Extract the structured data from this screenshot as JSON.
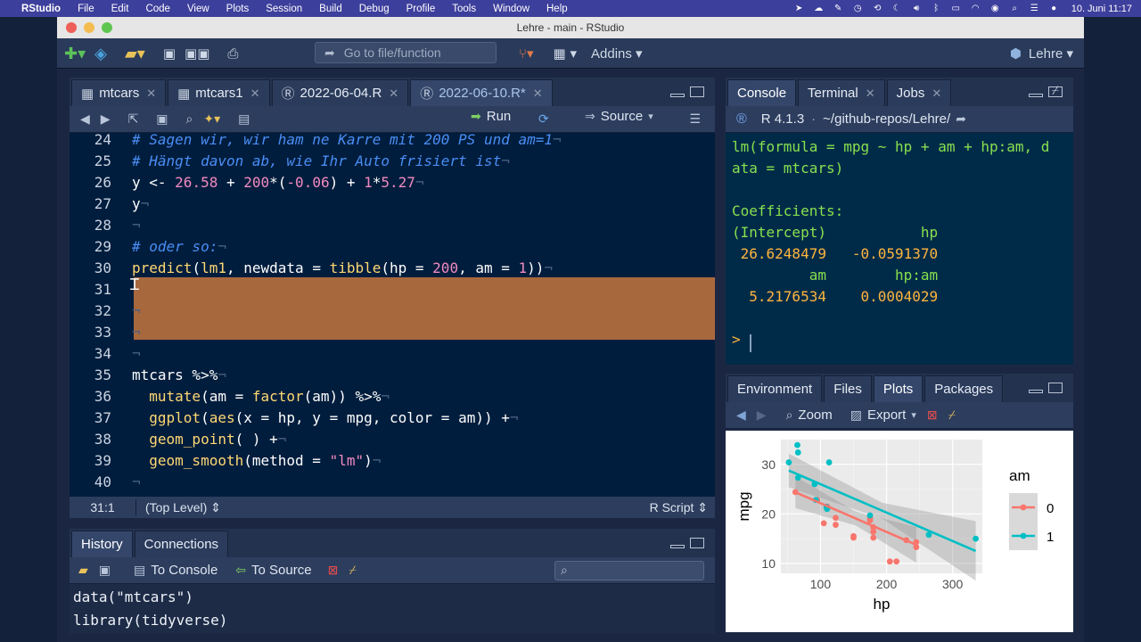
{
  "menubar": {
    "items": [
      "RStudio",
      "File",
      "Edit",
      "Code",
      "View",
      "Plots",
      "Session",
      "Build",
      "Debug",
      "Profile",
      "Tools",
      "Window",
      "Help"
    ],
    "datetime": "10. Juni 11:17"
  },
  "window": {
    "title": "Lehre - main - RStudio"
  },
  "toolbar": {
    "goto_placeholder": "Go to file/function",
    "addins_label": "Addins",
    "project_label": "Lehre"
  },
  "editor": {
    "tabs": [
      {
        "label": "mtcars",
        "type": "table"
      },
      {
        "label": "mtcars1",
        "type": "table"
      },
      {
        "label": "2022-06-04.R",
        "type": "r"
      },
      {
        "label": "2022-06-10.R*",
        "type": "r",
        "active": true
      }
    ],
    "run_label": "Run",
    "source_label": "Source",
    "lines": [
      {
        "n": "24",
        "html": "<span class=\"cm\"># Sagen wir, wir ham ne Karre mit 200 PS und am=1</span><span class=\"nl\">¬</span>"
      },
      {
        "n": "25",
        "html": "<span class=\"cm\"># Hängt davon ab, wie Ihr Auto frisiert ist</span><span class=\"nl\">¬</span>"
      },
      {
        "n": "26",
        "html": "y &lt;- <span class=\"num\">26.58</span> + <span class=\"num\">200</span>*(<span class=\"num\">-0.06</span>) + <span class=\"num\">1</span>*<span class=\"num\">5.27</span><span class=\"nl\">¬</span>"
      },
      {
        "n": "27",
        "html": "y<span class=\"nl\">¬</span>"
      },
      {
        "n": "28",
        "html": "<span class=\"nl\">¬</span>"
      },
      {
        "n": "29",
        "html": "<span class=\"cm\"># oder so:</span><span class=\"nl\">¬</span>"
      },
      {
        "n": "30",
        "html": "<span class=\"fn\">predict</span>(<span class=\"fn\">lm1</span>, newdata = <span class=\"fn\">tibble</span>(hp = <span class=\"num\">200</span>, am = <span class=\"num\">1</span>))<span class=\"nl\">¬</span>"
      },
      {
        "n": "31",
        "html": ""
      },
      {
        "n": "32",
        "html": "<span class=\"nl\">¬</span>"
      },
      {
        "n": "33",
        "html": "<span class=\"nl\">¬</span>"
      },
      {
        "n": "34",
        "html": "<span class=\"nl\">¬</span>"
      },
      {
        "n": "35",
        "html": "mtcars %&gt;%<span class=\"nl\">¬</span>"
      },
      {
        "n": "36",
        "html": "  <span class=\"fn\">mutate</span>(am = <span class=\"fn\">factor</span>(am)) %&gt;%<span class=\"nl\">¬</span>"
      },
      {
        "n": "37",
        "html": "  <span class=\"fn\">ggplot</span>(<span class=\"fn\">aes</span>(x = hp, y = mpg, color = am)) +<span class=\"nl\">¬</span>"
      },
      {
        "n": "38",
        "html": "  <span class=\"fn\">geom_point</span>( ) +<span class=\"nl\">¬</span>"
      },
      {
        "n": "39",
        "html": "  <span class=\"fn\">geom_smooth</span>(method = <span class=\"str\">\"lm\"</span>)<span class=\"nl\">¬</span>"
      },
      {
        "n": "40",
        "html": "<span class=\"nl\">¬</span>"
      }
    ],
    "status_pos": "31:1",
    "status_scope": "(Top Level)",
    "status_type": "R Script"
  },
  "console": {
    "tabs": [
      "Console",
      "Terminal",
      "Jobs"
    ],
    "version": "R 4.1.3",
    "path": "~/github-repos/Lehre/",
    "lines": [
      {
        "t": "lm(formula = mpg ~ hp + am + hp:am, d",
        "c": "g"
      },
      {
        "t": "ata = mtcars)",
        "c": "g"
      },
      {
        "t": "",
        "c": "g"
      },
      {
        "t": "Coefficients:",
        "c": "g"
      },
      {
        "t": "(Intercept)           hp",
        "c": "g"
      },
      {
        "t": " 26.6248479   -0.0591370",
        "c": "o"
      },
      {
        "t": "         am        hp:am",
        "c": "g"
      },
      {
        "t": "  5.2176534    0.0004029",
        "c": "o"
      },
      {
        "t": "",
        "c": "g"
      },
      {
        "t": "> ",
        "c": "p"
      }
    ]
  },
  "history": {
    "tabs": [
      "History",
      "Connections"
    ],
    "to_console": "To Console",
    "to_source": "To Source",
    "lines": [
      "data(\"mtcars\")",
      "library(tidyverse)"
    ]
  },
  "files": {
    "tabs": [
      "Environment",
      "Files",
      "Plots",
      "Packages"
    ],
    "zoom_label": "Zoom",
    "export_label": "Export"
  },
  "chart_data": {
    "type": "scatter",
    "xlabel": "hp",
    "ylabel": "mpg",
    "xlim": [
      40,
      345
    ],
    "ylim": [
      8,
      35
    ],
    "xticks": [
      100,
      200,
      300
    ],
    "yticks": [
      10,
      20,
      30
    ],
    "legend_title": "am",
    "legend_position": "right",
    "series": [
      {
        "name": "0",
        "color": "#f8766d",
        "x": [
          110,
          175,
          105,
          245,
          62,
          95,
          123,
          123,
          180,
          180,
          180,
          205,
          215,
          230,
          150,
          150,
          245,
          175,
          110
        ],
        "y": [
          21.4,
          18.7,
          18.1,
          14.3,
          24.4,
          22.8,
          19.2,
          17.8,
          16.4,
          17.3,
          15.2,
          10.4,
          10.4,
          14.7,
          15.5,
          15.2,
          13.3,
          19.2,
          21.5
        ],
        "fit": [
          [
            62,
            24.36
          ],
          [
            245,
            13.75
          ]
        ]
      },
      {
        "name": "1",
        "color": "#00bfc4",
        "x": [
          110,
          110,
          93,
          66,
          52,
          65,
          66,
          91,
          113,
          264,
          175,
          335,
          109
        ],
        "y": [
          21.0,
          21.0,
          22.8,
          32.4,
          30.4,
          33.9,
          27.3,
          26.0,
          30.4,
          15.8,
          19.7,
          15.0,
          21.4
        ],
        "fit": [
          [
            52,
            28.76
          ],
          [
            335,
            12.52
          ]
        ]
      }
    ]
  }
}
